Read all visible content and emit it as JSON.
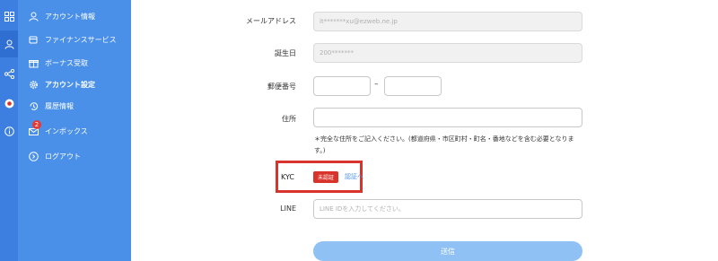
{
  "rail": {
    "icons": [
      "grid-icon",
      "user-icon",
      "share-icon",
      "record-icon",
      "info-icon"
    ]
  },
  "sidebar": {
    "items": [
      {
        "label": "アカウント情報",
        "icon": "user-icon"
      },
      {
        "label": "ファイナンスサービス",
        "icon": "finance-icon"
      },
      {
        "label": "ボーナス受取",
        "icon": "gift-icon"
      },
      {
        "label": "アカウント設定",
        "icon": "gear-icon"
      },
      {
        "label": "履歴情報",
        "icon": "history-icon"
      },
      {
        "label": "インボックス",
        "icon": "mail-icon",
        "badge": "2"
      },
      {
        "label": "ログアウト",
        "icon": "logout-icon"
      }
    ]
  },
  "form": {
    "email": {
      "label": "メールアドレス",
      "value": "it*******xu@ezweb.ne.jp"
    },
    "birthday": {
      "label": "誕生日",
      "value": "200*******"
    },
    "postal": {
      "label": "郵便番号",
      "separator": "–"
    },
    "address": {
      "label": "住所",
      "note": "＊完全な住所をご記入ください。(都道府県・市区町村・町名・番地などを含む必要となります。)"
    },
    "kyc": {
      "label": "KYC",
      "status": "未認証",
      "link": "認証へ"
    },
    "line": {
      "label": "LINE",
      "placeholder": "LINE IDを入力してください。"
    },
    "submit": "送信"
  },
  "colors": {
    "sidebar": "#4a90e8",
    "rail": "#3d7fe0",
    "kyc_highlight": "#d9342b",
    "submit": "#8fc1f5"
  }
}
